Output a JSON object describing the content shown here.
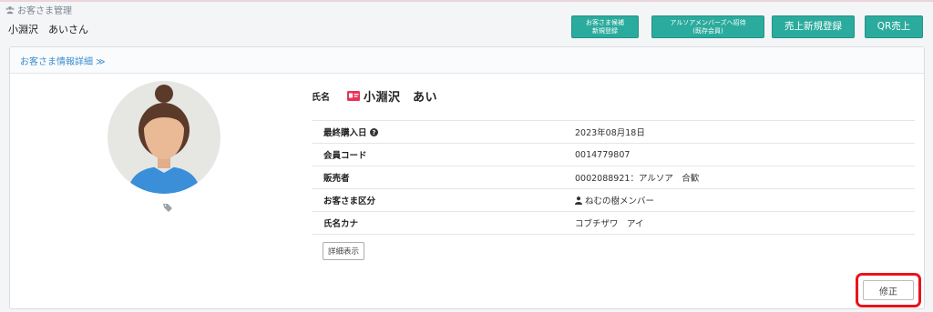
{
  "header": {
    "breadcrumb": "お客さま管理",
    "customer_name": "小淵沢　あいさん"
  },
  "actions": {
    "candidate_register_line1": "お客さま候補",
    "candidate_register_line2": "新規登録",
    "invite_member_line1": "アルソアメンバーズへ招待",
    "invite_member_line2": "(既存会員)",
    "new_sale": "売上新規登録",
    "qr_sale": "QR売上"
  },
  "panel": {
    "title": "お客さま情報詳細 ≫",
    "name_label": "氏名",
    "name_value": "小淵沢　あい",
    "rows": [
      {
        "label": "最終購入日",
        "value": "2023年08月18日"
      },
      {
        "label": "会員コード",
        "value": "0014779807"
      },
      {
        "label": "販売者",
        "value": "0002088921：アルソア　合歓"
      },
      {
        "label": "お客さま区分",
        "value": "ねむの樹メンバー"
      },
      {
        "label": "氏名カナ",
        "value": "コブチザワ　アイ"
      }
    ],
    "detail_button": "詳細表示",
    "edit_button": "修正"
  },
  "colors": {
    "accent_teal": "#2bab9d",
    "link_blue": "#3a8ed0",
    "highlight_red": "#e8141c"
  }
}
